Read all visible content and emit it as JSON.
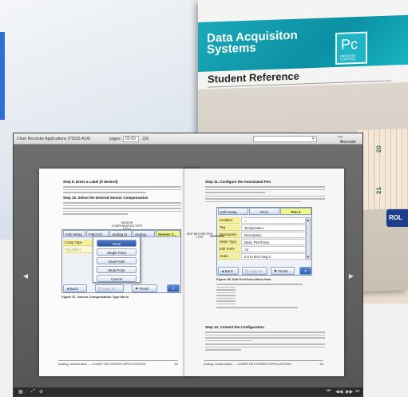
{
  "background": {
    "cover": {
      "title_line1": "Data Acquisiton",
      "title_line2": "Systems",
      "logo": "Pc",
      "logo_sub": "PROCESS CONTROL",
      "subtitle": "Student Reference",
      "chart_numbers": [
        "20",
        "21"
      ],
      "badge": "ROL"
    }
  },
  "viewer": {
    "document_title": "Chart Recorder Applications (T5552-A1A)",
    "pages_label": "pages:",
    "pages_value": "62-63",
    "total_pages": "236",
    "fullscreen_label": "Annotate"
  },
  "left_page": {
    "heading1": "Step 8. Enter a Label (if desired)",
    "heading2": "Step 10. Select the Desired Sensor Compensation",
    "callout": "SENSOR COMPENSATION TYPE MENU",
    "tabs": [
      "Edit Setup",
      "Field I/O",
      "Analog In",
      "Analog O...",
      "Sensor C..."
    ],
    "field_rows": [
      "Comp Type",
      "Trig Offset"
    ],
    "menu_items": [
      "None",
      "Single Point",
      "Dual Point",
      "Multi Point",
      "Cancel"
    ],
    "buttons": {
      "back": "Back",
      "copy_to": "Copy To",
      "finish": "Finish",
      "help": "?"
    },
    "caption": "Figure 57. Sensor Compensation Type Menu",
    "footer_left": "Analog Linearization — CHART RECORDER APPLICATIONS",
    "footer_page": "62"
  },
  "right_page": {
    "heading1": "Step 11. Configure the Associated Pen",
    "tabs": [
      "Edit Setup",
      "Pens",
      "Pen 2"
    ],
    "rows": [
      {
        "label": "Enabled",
        "value": "✓"
      },
      {
        "label": "Tag",
        "value": "Temperature"
      },
      {
        "label": "Description",
        "value": "Description"
      },
      {
        "label": "Mode Type",
        "value": "Basic Pen/Trace"
      },
      {
        "label": "Edit Prefs",
        "value": "A2"
      },
      {
        "label": "Scale",
        "value": "0.0 to 50.0 Deg C"
      }
    ],
    "callout": "EDIT RECORD PEN TYPE",
    "buttons": {
      "back": "Back",
      "copy_to": "Copy To",
      "finish": "Finish",
      "help": "?"
    },
    "caption": "Figure 58. Edit Pen/Trace Menu Item",
    "heading2": "Step 12. Commit the Configuration",
    "footer_left": "Analog Linearization — CHART RECORDER APPLICATIONS",
    "footer_page": "63"
  },
  "bottom": {
    "left_icons": [
      "grid-icon",
      "fullscreen-icon",
      "zoom-icon"
    ],
    "right_icons": [
      "first-page-icon",
      "previous-page-icon",
      "next-page-icon",
      "last-page-icon"
    ]
  }
}
